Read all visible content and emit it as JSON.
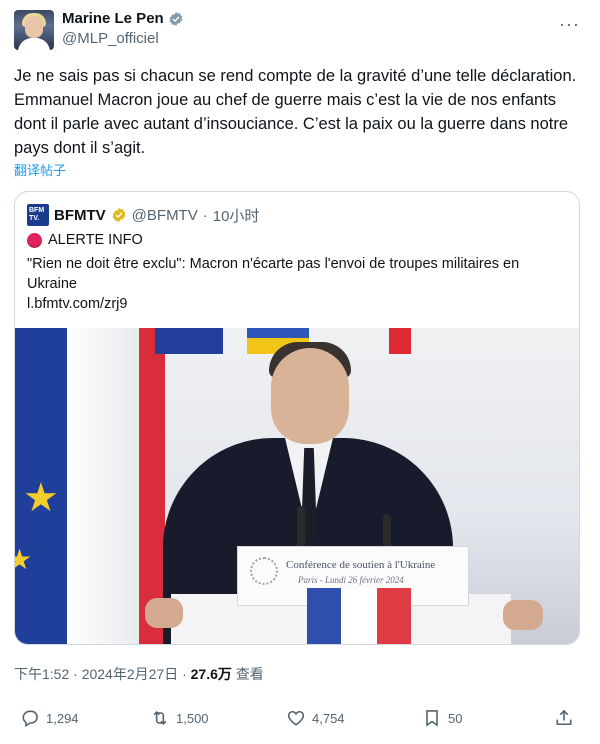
{
  "author": {
    "name": "Marine Le Pen",
    "handle": "@MLP_officiel",
    "verified_icon": "verified-badge-icon",
    "more_label": "···"
  },
  "tweet": {
    "text": "Je ne sais pas si chacun se rend compte de la gravité d’une telle déclaration. Emmanuel Macron joue au chef de guerre mais c’est la vie de nos enfants dont il parle avec autant d’insouciance. C’est la paix ou la guerre dans notre pays dont il s’agit.",
    "translate_label": "翻译帖子"
  },
  "quote": {
    "logo_text": "BFM TV.",
    "name": "BFMTV",
    "handle": "@BFMTV",
    "separator": "·",
    "time": "10小时",
    "alert": "ALERTE INFO",
    "body": "\"Rien ne doit être exclu\": Macron n'écarte pas l'envoi de troupes militaires en Ukraine",
    "link": "l.bfmtv.com/zrj9",
    "photo": {
      "sign_title": "Conférence de soutien à l'Ukraine",
      "sign_sub": "Paris - Lundi 26 février 2024"
    }
  },
  "meta": {
    "time": "下午1:52 · 2024年2月27日 · ",
    "views": "27.6万",
    "views_suffix": " 查看"
  },
  "actions": {
    "replies": "1,294",
    "retweets": "1,500",
    "likes": "4,754",
    "bookmarks": "50"
  },
  "colors": {
    "accent": "#1d9bf0",
    "text": "#0f1419",
    "muted": "#536471",
    "border": "#cfd9de"
  }
}
